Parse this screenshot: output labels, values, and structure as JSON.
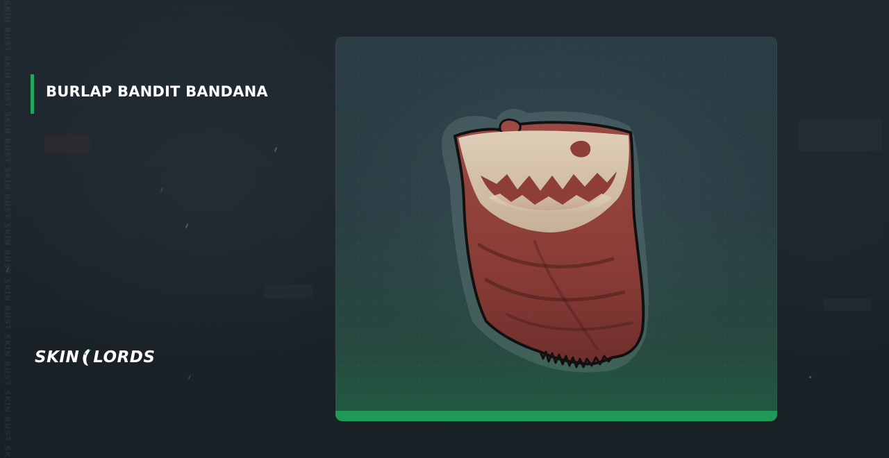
{
  "item": {
    "title": "BURLAP BANDIT BANDANA",
    "image_icon": "bandana-skin-icon"
  },
  "brand": {
    "name_part1": "SKIN",
    "name_part2": "LORDS",
    "logo_icon": "skinlords-logo-icon"
  },
  "watermark": {
    "vertical_text": "SKIN RUST SKIN RUST SKIN RUST SKIN RUST SKIN RUST SKIN RUST SKIN RUST SKIN RUST SKIN RUST SKIN RUST"
  },
  "colors": {
    "accent_green": "#20a95b",
    "card_footer_green": "#1f9a57",
    "bandana_red": "#8e3e37",
    "bandana_cream": "#d8c8b3",
    "background": "#1c252b"
  }
}
